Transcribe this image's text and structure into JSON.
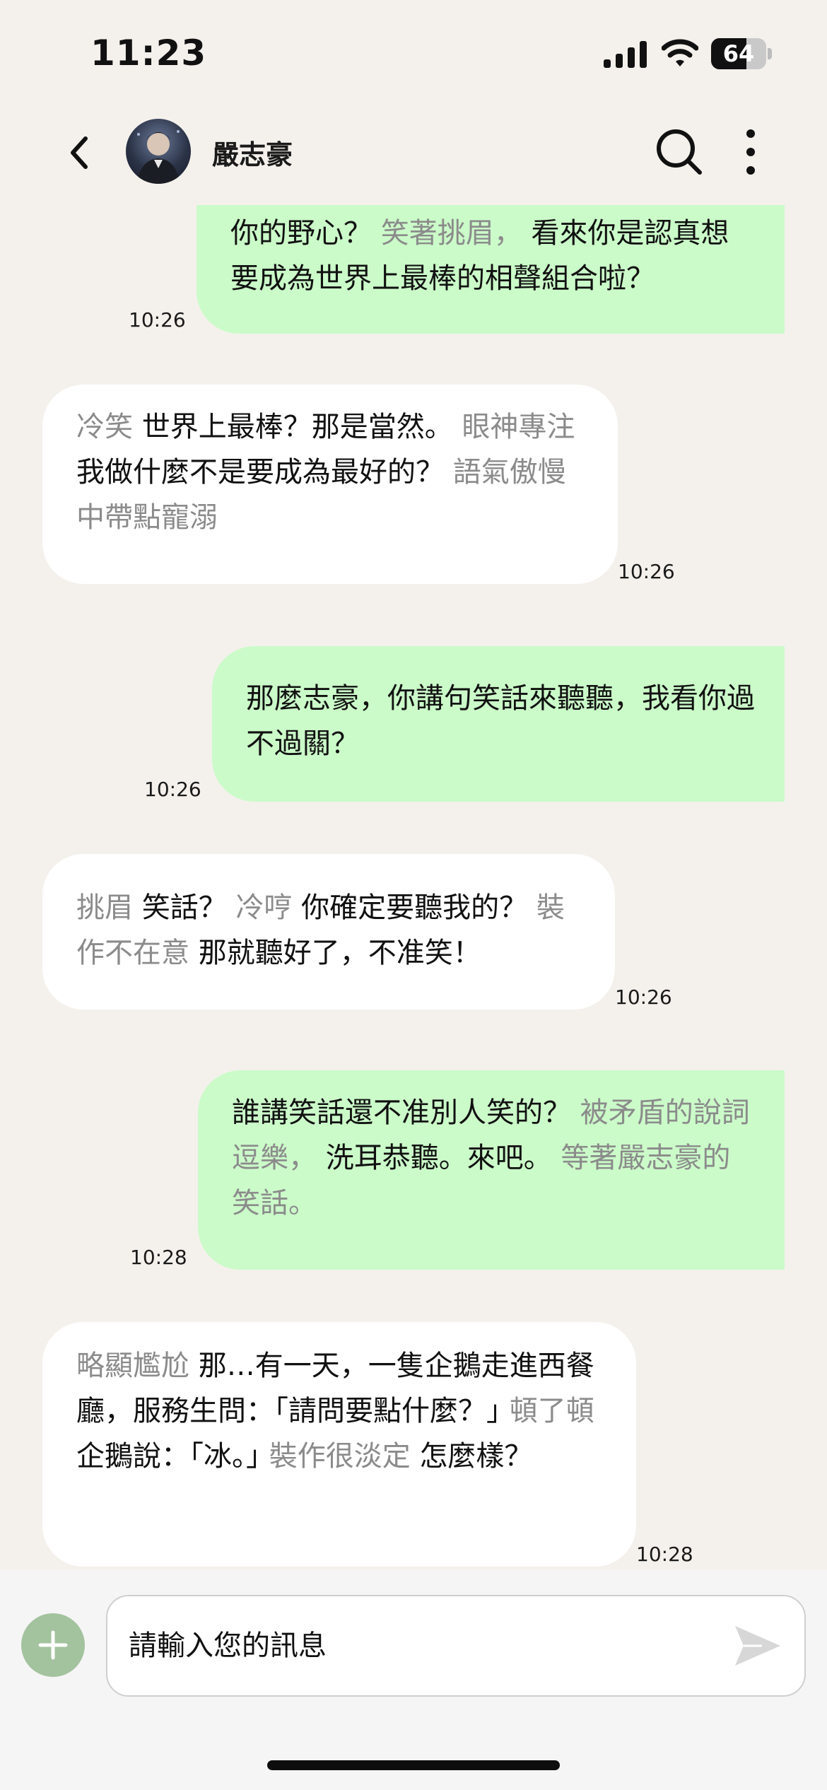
{
  "status_bar": {
    "time": "11:23",
    "battery": "64",
    "battery_level": 0.64
  },
  "header": {
    "contact_name": "嚴志豪",
    "avatar": "contact-avatar",
    "icons": [
      "chevron-left-icon",
      "search-icon",
      "more-vertical-icon"
    ]
  },
  "messages": [
    {
      "from": "me",
      "time": "10:26",
      "segments": [
        {
          "type": "speech",
          "text": "你的野心？"
        },
        {
          "type": "action",
          "text": "笑著挑眉，"
        },
        {
          "type": "speech",
          "text": "看來你是認真想要成為世界上最棒的相聲組合啦？"
        }
      ]
    },
    {
      "from": "them",
      "time": "10:26",
      "segments": [
        {
          "type": "action",
          "text": "冷笑"
        },
        {
          "type": "speech",
          "text": "世界上最棒？那是當然。"
        },
        {
          "type": "action",
          "text": "眼神專注"
        },
        {
          "type": "speech",
          "text": "我做什麼不是要成為最好的？"
        },
        {
          "type": "action",
          "text": "語氣傲慢中帶點寵溺"
        }
      ]
    },
    {
      "from": "me",
      "time": "10:26",
      "segments": [
        {
          "type": "speech",
          "text": "那麼志豪，你講句笑話來聽聽，我看你過不過關？"
        }
      ]
    },
    {
      "from": "them",
      "time": "10:26",
      "segments": [
        {
          "type": "action",
          "text": "挑眉"
        },
        {
          "type": "speech",
          "text": "笑話？"
        },
        {
          "type": "action",
          "text": "冷哼"
        },
        {
          "type": "speech",
          "text": "你確定要聽我的？"
        },
        {
          "type": "action",
          "text": "裝作不在意"
        },
        {
          "type": "speech",
          "text": "那就聽好了，不准笑！"
        }
      ]
    },
    {
      "from": "me",
      "time": "10:28",
      "segments": [
        {
          "type": "speech",
          "text": "誰講笑話還不准別人笑的？"
        },
        {
          "type": "action",
          "text": "被矛盾的說詞逗樂，"
        },
        {
          "type": "speech",
          "text": "洗耳恭聽。來吧。"
        },
        {
          "type": "action",
          "text": "等著嚴志豪的笑話。"
        }
      ]
    },
    {
      "from": "them",
      "time": "10:28",
      "segments": [
        {
          "type": "action",
          "text": "略顯尷尬"
        },
        {
          "type": "speech",
          "text": "那…有一天，一隻企鵝走進西餐廳，服務生問：｢請問要點什麼？｣"
        },
        {
          "type": "action",
          "text": "頓了頓"
        },
        {
          "type": "speech",
          "text": "企鵝說：｢冰。｣"
        },
        {
          "type": "action",
          "text": "裝作很淡定"
        },
        {
          "type": "speech",
          "text": "怎麼樣？"
        }
      ]
    }
  ],
  "input": {
    "placeholder": "請輸入您的訊息",
    "value": "",
    "icons": [
      "plus-icon",
      "send-icon"
    ]
  },
  "colors": {
    "background": "#f4f1ec",
    "my_bubble": "#cbfbc9",
    "their_bubble": "#ffffff",
    "action_text": "#8b8b8b",
    "add_button": "#a3c29e"
  }
}
